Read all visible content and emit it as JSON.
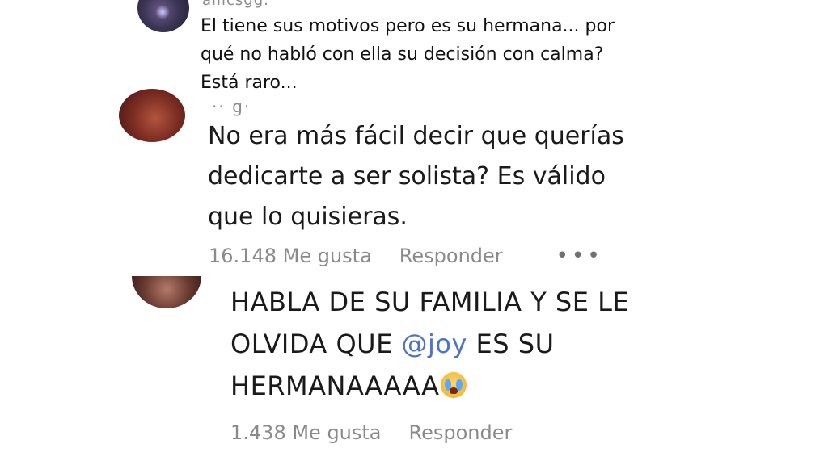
{
  "comments": [
    {
      "username": "aliicsgg.",
      "text_lines": [
        "El tiene sus motivos pero es su hermana... por",
        "qué no habló con ella su decisión con calma?",
        "Está raro..."
      ]
    },
    {
      "username": "·· g·",
      "text_lines": [
        "No era más fácil decir que querías",
        "dedicarte a ser solista? Es válido",
        "que lo quisieras."
      ],
      "likes": "16.148 Me gusta",
      "reply": "Responder",
      "more": "•••"
    },
    {
      "line1": "HABLA DE SU FAMILIA Y SE LE",
      "line2_before": "OLVIDA QUE ",
      "mention": "@joy",
      "line2_after": " ES SU",
      "line3": "HERMANAAAAA",
      "emoji": "crying-face",
      "likes": "1.438 Me gusta",
      "reply": "Responder"
    }
  ],
  "colors": {
    "text": "#111111",
    "meta": "#8a8a8a",
    "mention": "#4f73c9"
  }
}
